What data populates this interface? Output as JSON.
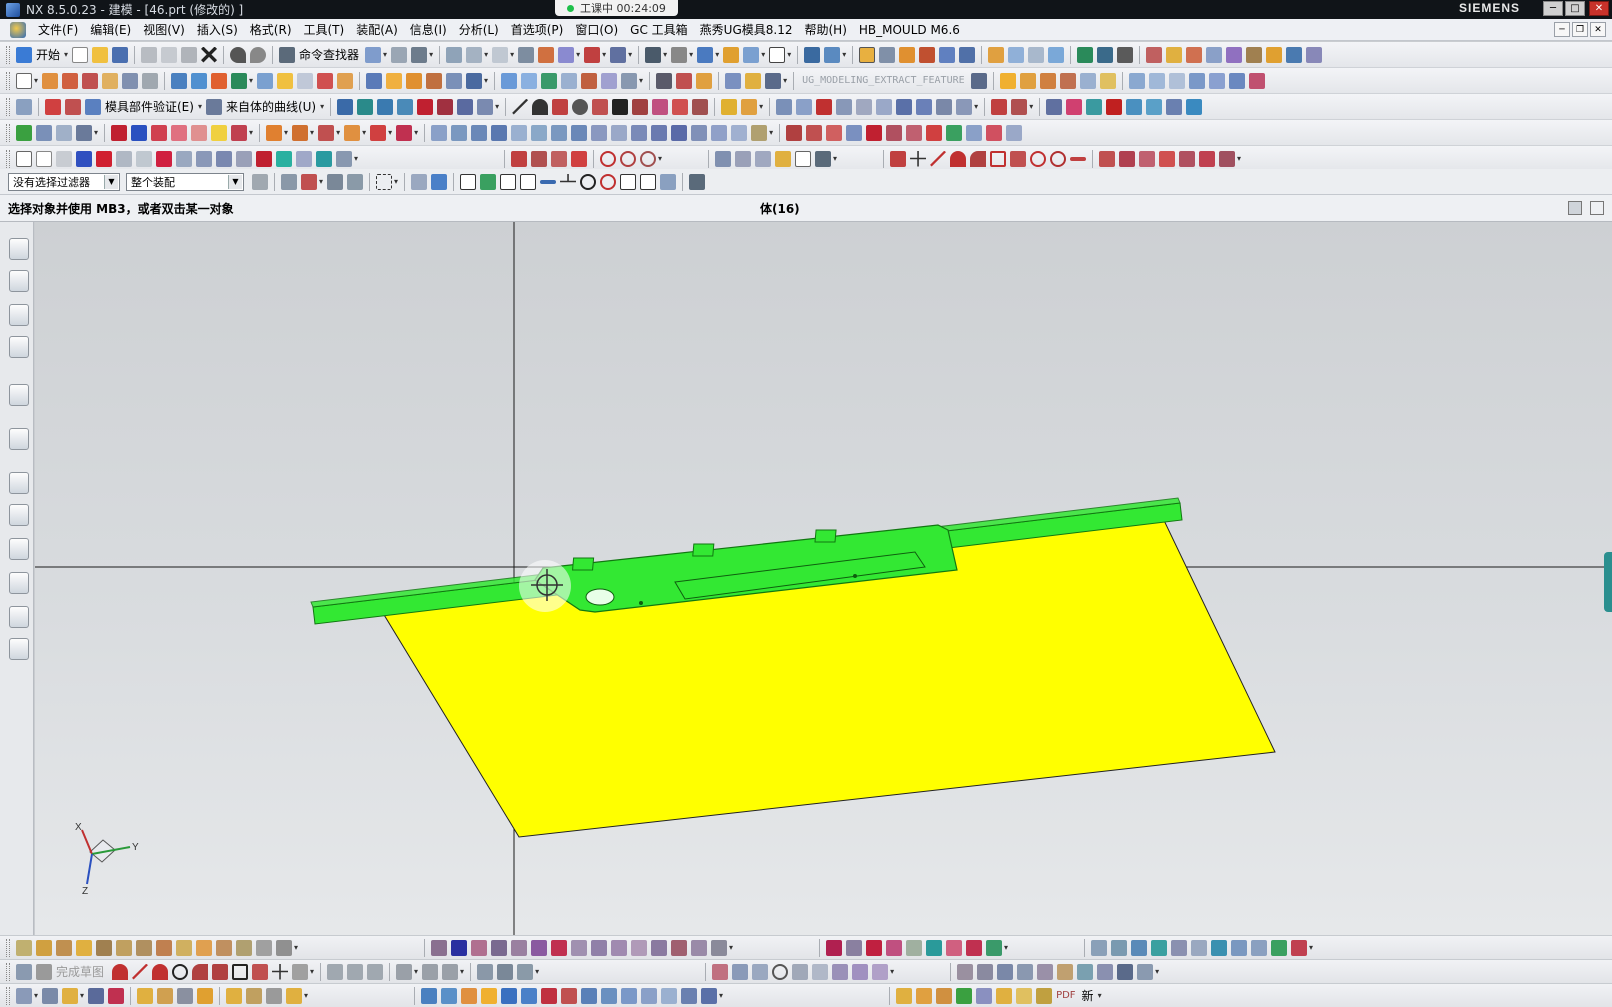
{
  "window": {
    "title": "NX 8.5.0.23 - 建模 - [46.prt  (修改的) ]",
    "recording_status": "工课中 00:24:09",
    "brand": "SIEMENS",
    "minimize": "─",
    "maximize": "□",
    "close": "✕"
  },
  "menubar": {
    "items": [
      "文件(F)",
      "编辑(E)",
      "视图(V)",
      "插入(S)",
      "格式(R)",
      "工具(T)",
      "装配(A)",
      "信息(I)",
      "分析(L)",
      "首选项(P)",
      "窗口(O)",
      "GC 工具箱",
      "燕秀UG模具8.12",
      "帮助(H)",
      "HB_MOULD M6.6"
    ]
  },
  "toolbar": {
    "start_label": "开始",
    "command_finder_label": "命令查找器",
    "extract_feature_label": "UG_MODELING_EXTRACT_FEATURE",
    "mold_verify_label": "模具部件验证(E)",
    "curve_from_body_label": "来自体的曲线(U)"
  },
  "selection": {
    "filter_value": "没有选择过滤器",
    "scope_value": "整个装配"
  },
  "status": {
    "prompt": "选择对象并使用 MB3，或者双击某一对象",
    "selection_info": "体(16)"
  },
  "viewport": {
    "colors": {
      "sheet": "#ffff00",
      "rail": "#33e833",
      "background": "#d6d9dc"
    },
    "triad_labels": {
      "x": "X",
      "y": "Y",
      "z": "Z"
    }
  },
  "sketch_toolbar": {
    "finish_sketch_label": "完成草图"
  },
  "bottom_toolbar": {
    "pdf_label": "PDF",
    "new_label": "新"
  }
}
